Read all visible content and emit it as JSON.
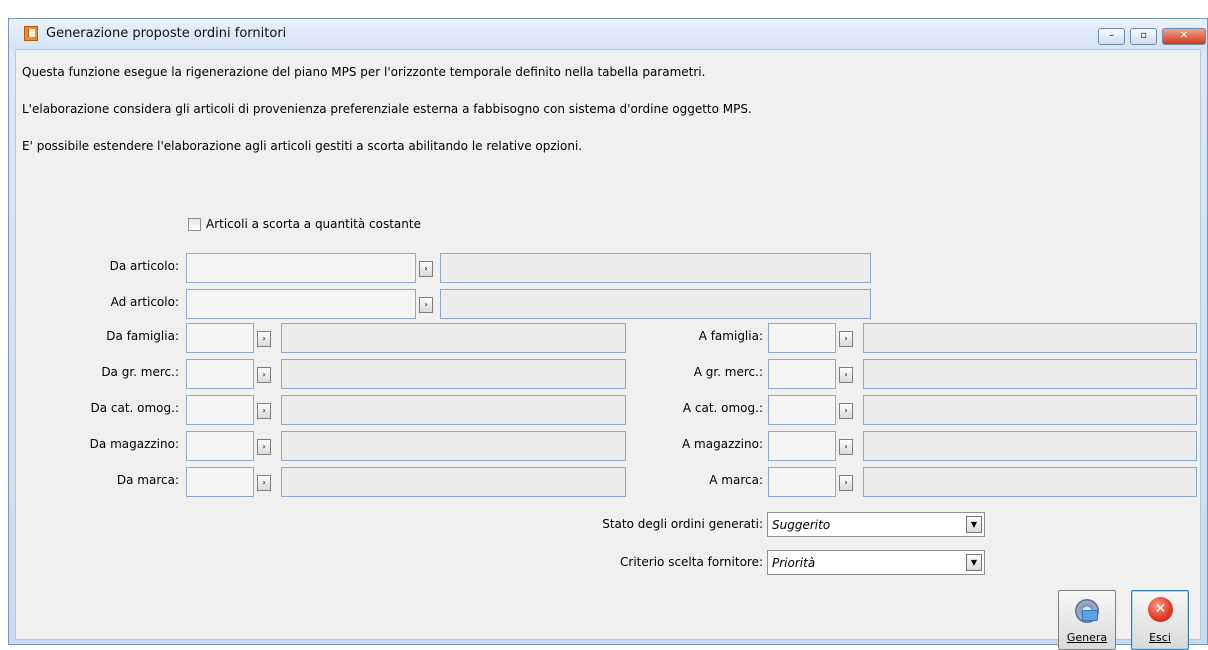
{
  "window": {
    "title": "Generazione proposte ordini fornitori",
    "controls": {
      "minimize": "–",
      "maximize": "▫",
      "close": "✕"
    }
  },
  "info_lines": [
    "Questa funzione esegue la rigenerazione del piano MPS per l'orizzonte temporale definito nella tabella parametri.",
    "L'elaborazione considera gli articoli di provenienza preferenziale esterna a fabbisogno con sistema d'ordine oggetto MPS.",
    "E' possibile estendere l'elaborazione agli articoli gestiti a scorta abilitando le relative opzioni."
  ],
  "checkbox": {
    "label": "Articoli a scorta a quantità costante",
    "checked": false
  },
  "zoom_glyph": "›",
  "ranges": {
    "da_articolo": {
      "label": "Da articolo:",
      "value": "",
      "description": ""
    },
    "ad_articolo": {
      "label": "Ad articolo:",
      "value": "",
      "description": ""
    }
  },
  "left_filters": [
    {
      "label": "Da famiglia:",
      "value": "",
      "description": ""
    },
    {
      "label": "Da gr. merc.:",
      "value": "",
      "description": ""
    },
    {
      "label": "Da cat. omog.:",
      "value": "",
      "description": ""
    },
    {
      "label": "Da magazzino:",
      "value": "",
      "description": ""
    },
    {
      "label": "Da marca:",
      "value": "",
      "description": ""
    }
  ],
  "right_filters": [
    {
      "label": "A famiglia:",
      "value": "",
      "description": ""
    },
    {
      "label": "A gr. merc.:",
      "value": "",
      "description": ""
    },
    {
      "label": "A cat. omog.:",
      "value": "",
      "description": ""
    },
    {
      "label": "A magazzino:",
      "value": "",
      "description": ""
    },
    {
      "label": "A marca:",
      "value": "",
      "description": ""
    }
  ],
  "stato": {
    "label": "Stato degli ordini generati:",
    "value": "Suggerito"
  },
  "criterio": {
    "label": "Criterio scelta fornitore:",
    "value": "Priorità"
  },
  "dropdown_arrow": "▼",
  "buttons": {
    "genera": {
      "label": "Genera",
      "icon": "gear-icon"
    },
    "esci": {
      "label": "Esci",
      "icon": "close-circle-icon",
      "glyph": "✕"
    }
  }
}
